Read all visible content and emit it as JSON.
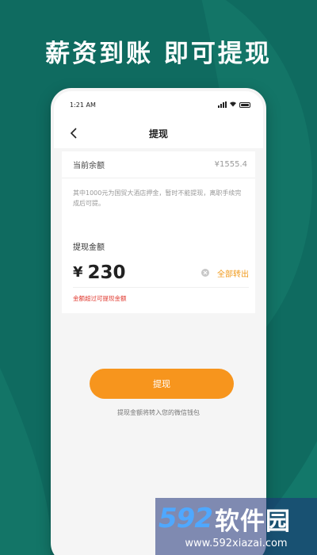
{
  "headline": "薪资到账  即可提现",
  "status_bar": {
    "time": "1:21 AM"
  },
  "nav": {
    "title": "提现"
  },
  "balance": {
    "label": "当前余额",
    "value": "¥1555.4",
    "notice": "其中1000元为国贸大酒店押金，暂时不能提现，离职手续完成后可提。"
  },
  "withdraw": {
    "label": "提现金额",
    "currency": "¥",
    "amount": "230",
    "all_out_label": "全部转出",
    "error": "金额超过可提现金额"
  },
  "submit": {
    "label": "提现"
  },
  "hint": "提现金额将转入您的微信钱包",
  "watermark": {
    "number": "592",
    "name": "软件园",
    "url": "www.592xiazai.com"
  },
  "colors": {
    "background": "#0f6b60",
    "accent": "#f7951d",
    "error": "#e0382e"
  },
  "icons": [
    "back-chevron-icon",
    "signal-icon",
    "wifi-icon",
    "battery-icon",
    "clear-icon"
  ]
}
